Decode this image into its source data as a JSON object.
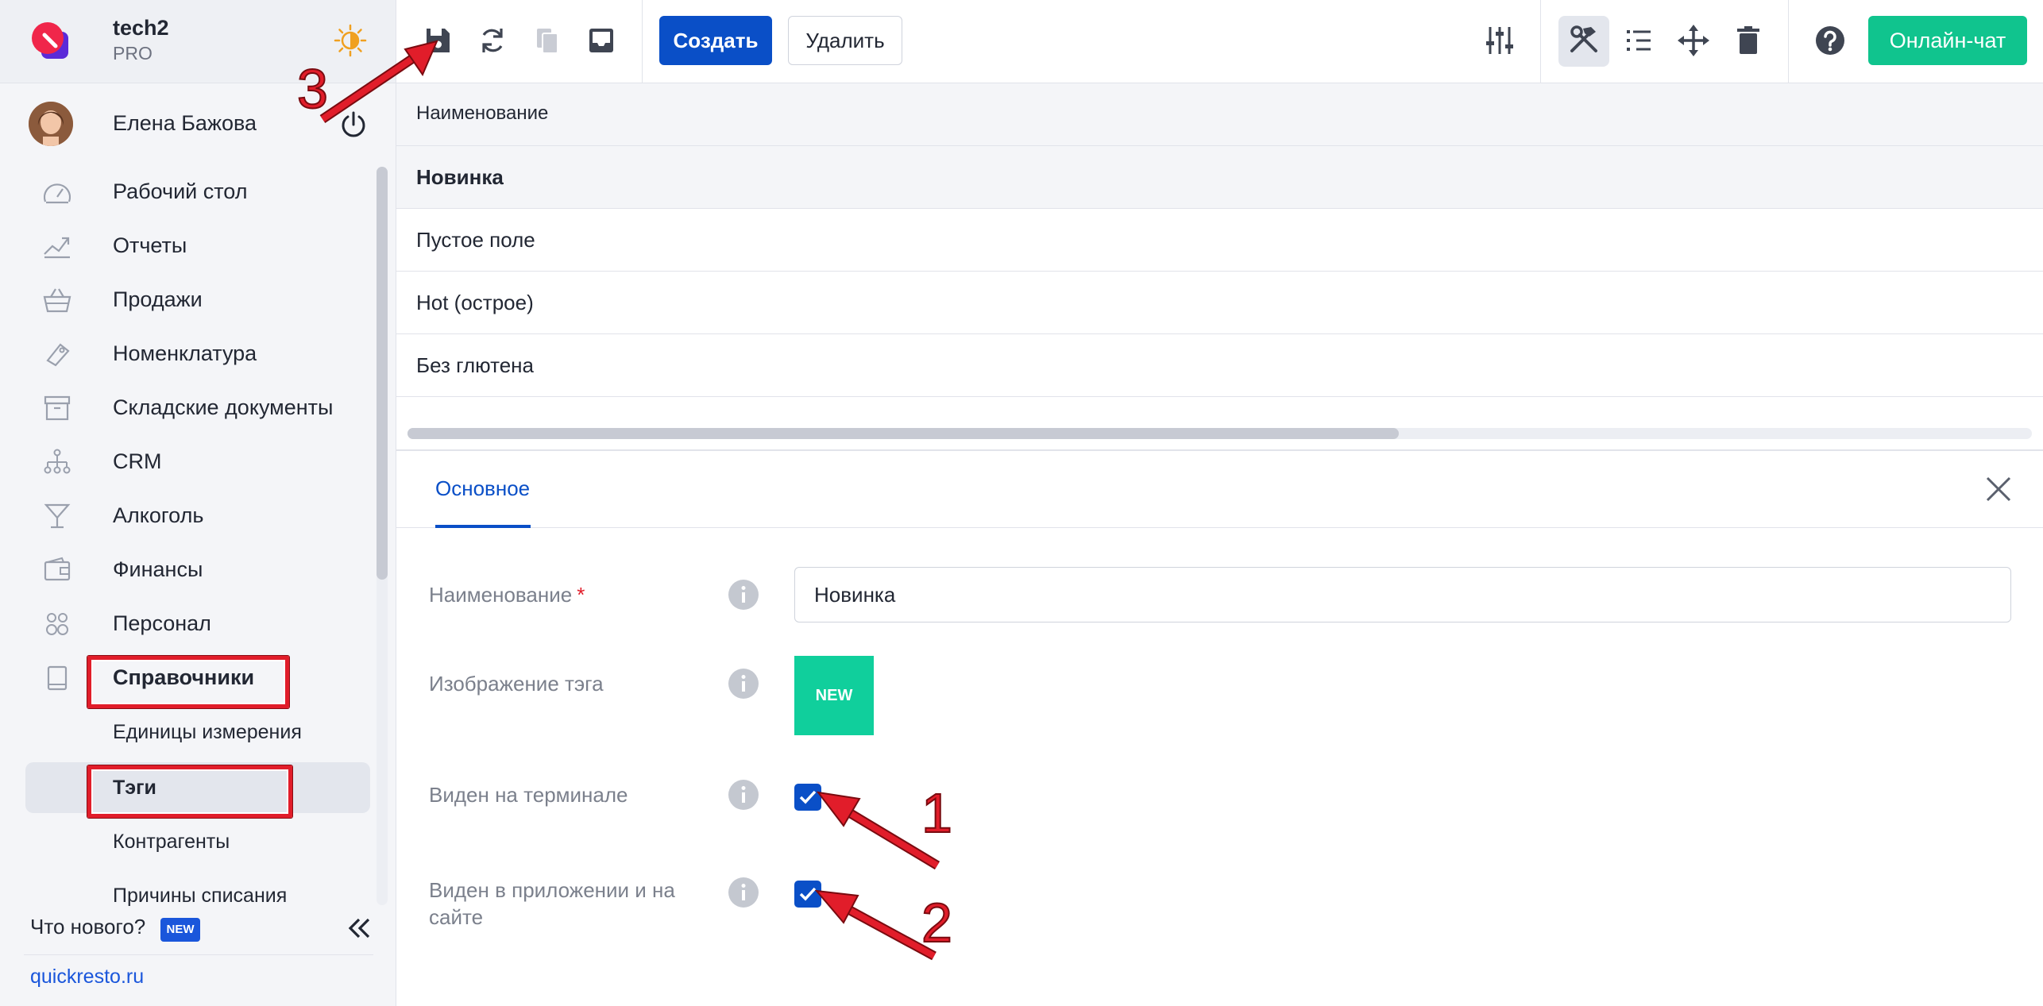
{
  "brand": {
    "name": "tech2",
    "plan": "PRO"
  },
  "user": {
    "name": "Елена Бажова"
  },
  "nav": {
    "items": [
      {
        "label": "Рабочий стол",
        "icon": "dashboard-icon"
      },
      {
        "label": "Отчеты",
        "icon": "chart-icon"
      },
      {
        "label": "Продажи",
        "icon": "basket-icon"
      },
      {
        "label": "Номенклатура",
        "icon": "tag-icon"
      },
      {
        "label": "Складские документы",
        "icon": "archive-icon"
      },
      {
        "label": "CRM",
        "icon": "hierarchy-icon"
      },
      {
        "label": "Алкоголь",
        "icon": "glass-icon"
      },
      {
        "label": "Финансы",
        "icon": "wallet-icon"
      },
      {
        "label": "Персонал",
        "icon": "people-icon"
      },
      {
        "label": "Справочники",
        "icon": "book-icon"
      }
    ],
    "subitems": [
      {
        "label": "Единицы измерения"
      },
      {
        "label": "Тэги"
      },
      {
        "label": "Контрагенты"
      },
      {
        "label": "Причины списания"
      }
    ],
    "whats_new": "Что нового?",
    "new_badge": "NEW",
    "footer_link": "quickresto.ru"
  },
  "toolbar": {
    "create_label": "Создать",
    "delete_label": "Удалить",
    "chat_label": "Онлайн-чат"
  },
  "table": {
    "header": "Наименование",
    "rows": [
      "Новинка",
      "Пустое поле",
      "Hot (острое)",
      "Без глютена"
    ]
  },
  "form": {
    "tab": "Основное",
    "name_label": "Наименование",
    "name_required": "*",
    "name_value": "Новинка",
    "image_label": "Изображение тэга",
    "image_text": "NEW",
    "terminal_label": "Виден на терминале",
    "terminal_checked": true,
    "app_label": "Виден в приложении и на сайте",
    "app_checked": true
  },
  "annotations": {
    "n1": "1",
    "n2": "2",
    "n3": "3"
  },
  "colors": {
    "accent": "#0a4fc7",
    "chat": "#10c48e",
    "tag": "#10cf9c",
    "highlight": "#e11d2a"
  }
}
